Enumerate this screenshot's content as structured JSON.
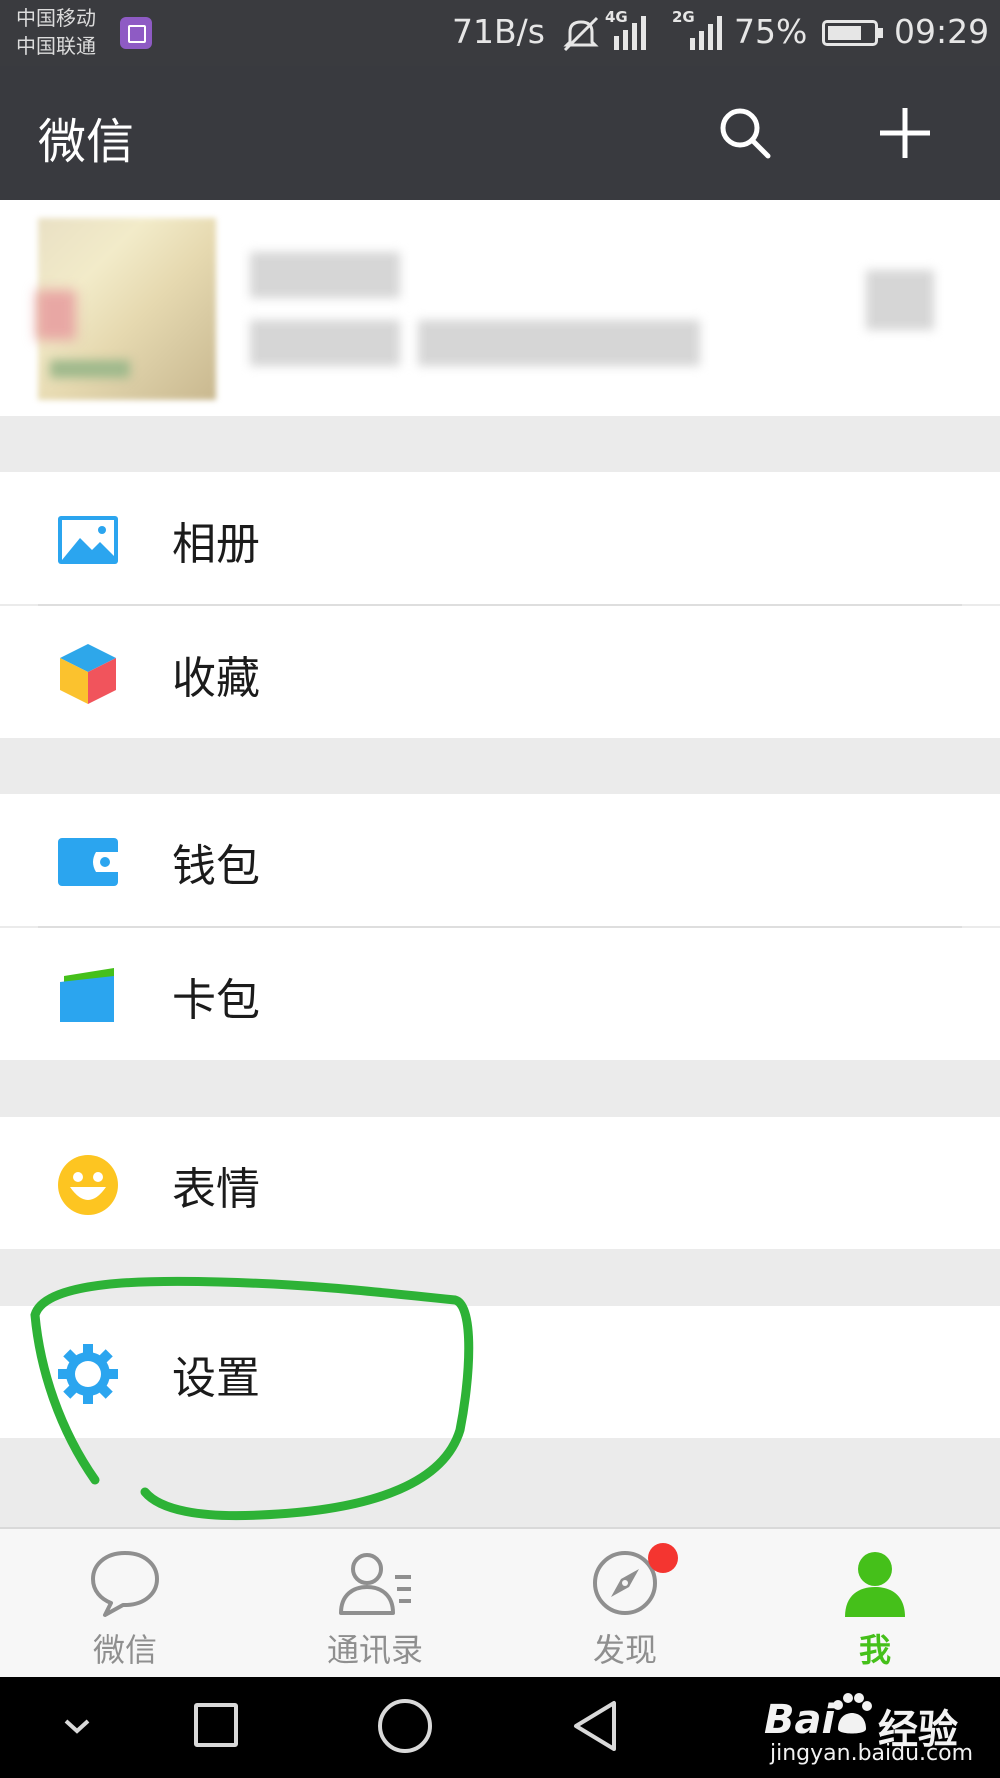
{
  "status_bar": {
    "carrier_1": "中国移动",
    "carrier_2": "中国联通",
    "net_speed": "71B/s",
    "net_4g": "4G",
    "net_2g": "2G",
    "battery": "75%",
    "battery_level": 0.75,
    "time": "09:29"
  },
  "top_bar": {
    "title": "微信",
    "search_icon": "search-icon",
    "add_icon": "plus-icon"
  },
  "menu": {
    "album": "相册",
    "favorites": "收藏",
    "wallet": "钱包",
    "card_package": "卡包",
    "stickers": "表情",
    "settings": "设置"
  },
  "tabs": [
    {
      "label": "微信",
      "icon": "chat-bubble-icon",
      "active": false
    },
    {
      "label": "通讯录",
      "icon": "contacts-icon",
      "active": false
    },
    {
      "label": "发现",
      "icon": "compass-icon",
      "active": false,
      "badge": true
    },
    {
      "label": "我",
      "icon": "person-icon",
      "active": true
    }
  ],
  "watermark": {
    "logo": "Bai",
    "logo2": "经验",
    "url": "jingyan.baidu.com"
  },
  "colors": {
    "accent": "#45c01a",
    "badge": "#f43530",
    "header": "#393a3f",
    "annotation_circle": "#2db236"
  }
}
